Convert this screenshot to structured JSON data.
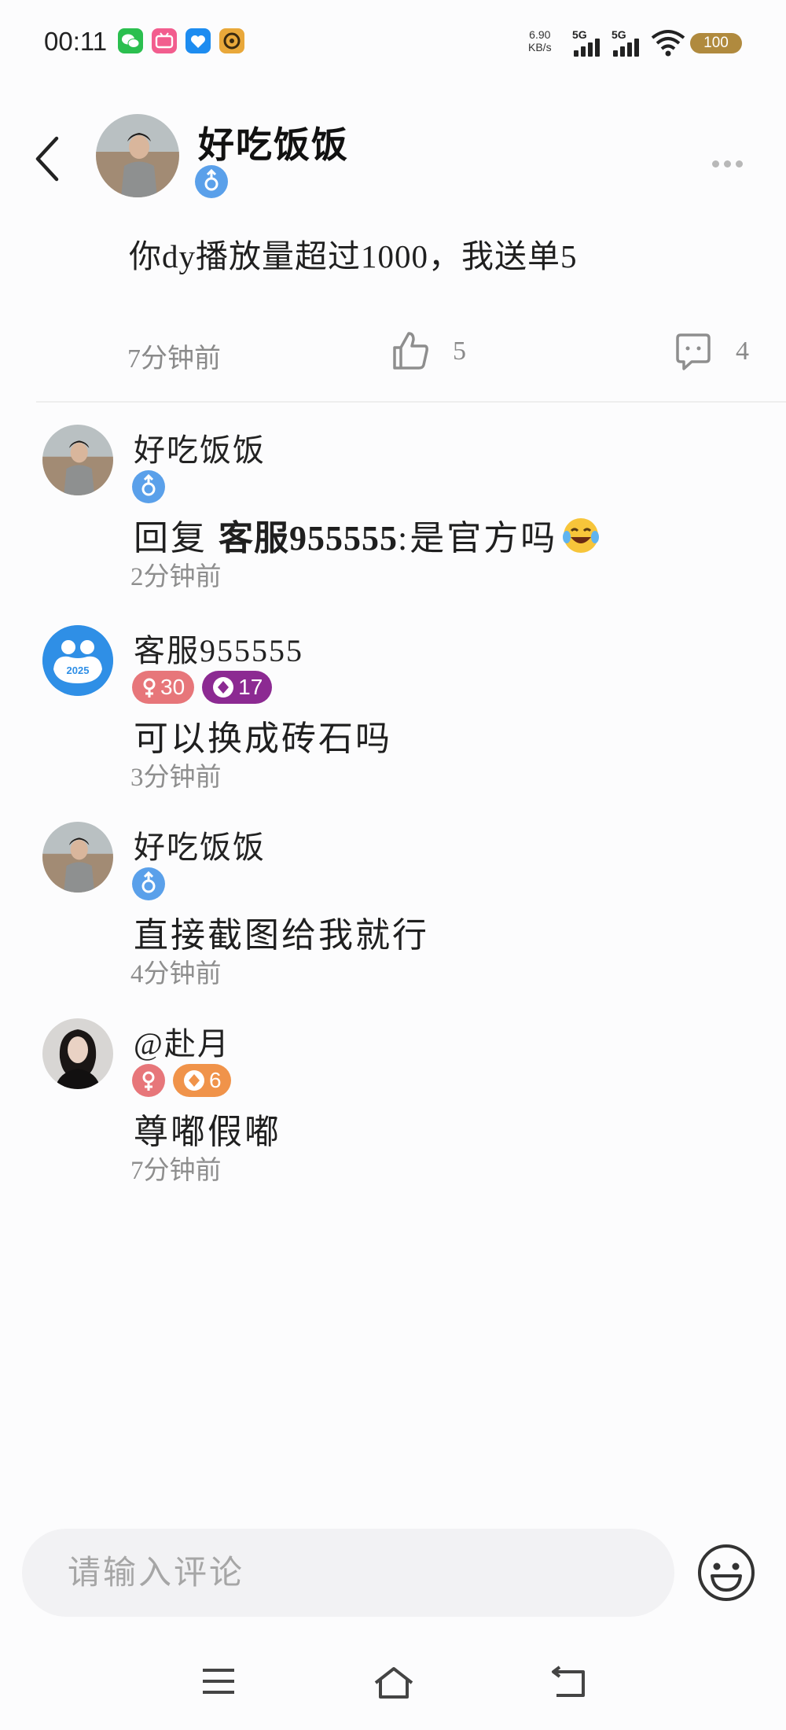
{
  "status_bar": {
    "time": "00:11",
    "net_speed_value": "6.90",
    "net_speed_unit": "KB/s",
    "signal1_label": "5G",
    "signal2_label": "5G",
    "battery": "100",
    "app_icons": [
      "wechat-icon",
      "bilibili-icon",
      "alipay-icon",
      "music-app-icon"
    ]
  },
  "post": {
    "author": "好吃饭饭",
    "gender_icon": "male-icon",
    "content": "你dy播放量超过1000，我送单5",
    "time": "7分钟前",
    "likes": "5",
    "comments": "4"
  },
  "comments": [
    {
      "name": "好吃饭饭",
      "badges": [
        {
          "type": "gender-male"
        }
      ],
      "reply_prefix": "回复 ",
      "reply_target": "客服955555",
      "text": ":是官方吗",
      "emoji": "laughing-tears-emoji",
      "time": "2分钟前"
    },
    {
      "name": "客服955555",
      "badges": [
        {
          "type": "gender-female-level",
          "text": "30"
        },
        {
          "type": "diamond-level",
          "text": "17"
        }
      ],
      "text": "可以换成砖石吗",
      "avatar_text": "2025",
      "time": "3分钟前"
    },
    {
      "name": "好吃饭饭",
      "badges": [
        {
          "type": "gender-male"
        }
      ],
      "text": "直接截图给我就行",
      "time": "4分钟前"
    },
    {
      "name": "@赴月",
      "badges": [
        {
          "type": "gender-female"
        },
        {
          "type": "diamond-level",
          "text": "6"
        }
      ],
      "text": "尊嘟假嘟",
      "time": "7分钟前"
    }
  ],
  "input": {
    "placeholder": "请输入评论"
  },
  "colors": {
    "male_badge": "#5aa0ea",
    "female_badge": "#e7767a",
    "diamond_purple": "#8c2a92",
    "diamond_orange": "#f0934a",
    "battery": "#b08a3e"
  }
}
